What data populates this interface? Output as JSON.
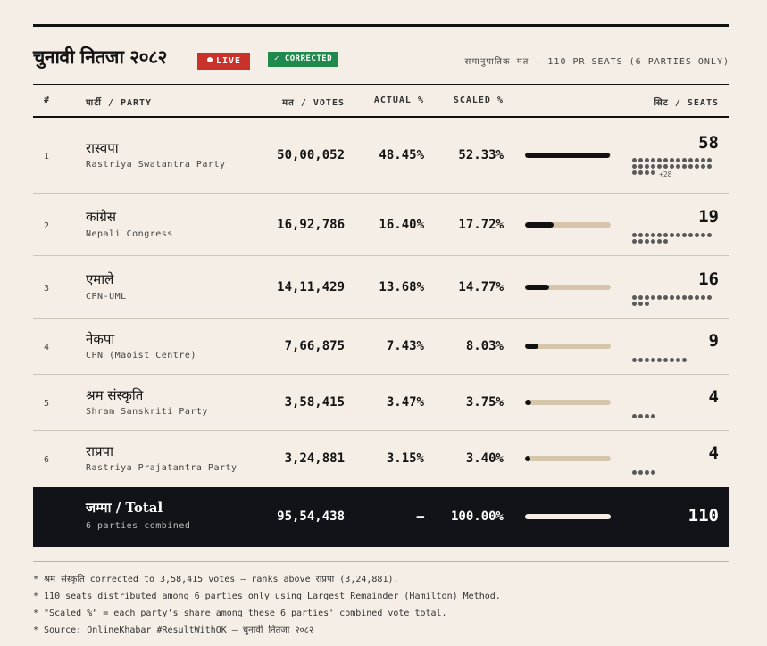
{
  "header": {
    "title": "चुनावी नितजा २०८२",
    "live_label": "LIVE",
    "corrected_label": "✓ CORRECTED",
    "subtitle": "समानुपातिक मत — 110 PR SEATS (6 PARTIES ONLY)"
  },
  "columns": {
    "rank": "#",
    "party": "पार्टी / PARTY",
    "votes": "मत / VOTES",
    "actual": "ACTUAL %",
    "scaled": "SCALED %",
    "seats": "सिट / SEATS"
  },
  "rows": [
    {
      "rank": "1",
      "name": "रास्वपा",
      "name_en": "Rastriya Swatantra Party",
      "votes": "50,00,052",
      "actual": "48.45%",
      "scaled": "52.33%",
      "share": 0.5233,
      "seats": "58",
      "dots_shown": 30,
      "extra": "+28"
    },
    {
      "rank": "2",
      "name": "कांग्रेस",
      "name_en": "Nepali Congress",
      "votes": "16,92,786",
      "actual": "16.40%",
      "scaled": "17.72%",
      "share": 0.1772,
      "seats": "19",
      "dots_shown": 19,
      "extra": ""
    },
    {
      "rank": "3",
      "name": "एमाले",
      "name_en": "CPN-UML",
      "votes": "14,11,429",
      "actual": "13.68%",
      "scaled": "14.77%",
      "share": 0.1477,
      "seats": "16",
      "dots_shown": 16,
      "extra": ""
    },
    {
      "rank": "4",
      "name": "नेकपा",
      "name_en": "CPN (Maoist Centre)",
      "votes": "7,66,875",
      "actual": "7.43%",
      "scaled": "8.03%",
      "share": 0.0803,
      "seats": "9",
      "dots_shown": 9,
      "extra": ""
    },
    {
      "rank": "5",
      "name": "श्रम संस्कृति",
      "name_en": "Shram Sanskriti Party",
      "votes": "3,58,415",
      "actual": "3.47%",
      "scaled": "3.75%",
      "share": 0.0375,
      "seats": "4",
      "dots_shown": 4,
      "extra": ""
    },
    {
      "rank": "6",
      "name": "राप्रपा",
      "name_en": "Rastriya Prajatantra Party",
      "votes": "3,24,881",
      "actual": "3.15%",
      "scaled": "3.40%",
      "share": 0.034,
      "seats": "4",
      "dots_shown": 4,
      "extra": ""
    }
  ],
  "total": {
    "name": "जम्मा / Total",
    "sub": "6 parties combined",
    "votes": "95,54,438",
    "actual": "—",
    "scaled": "100.00%",
    "share": 1.0,
    "seats": "110"
  },
  "notes": [
    "* श्रम संस्कृति corrected to 3,58,415 votes — ranks above राप्रपा (3,24,881).",
    "* 110 seats distributed among 6 parties only using Largest Remainder (Hamilton) Method.",
    "* \"Scaled %\" = each party's share among these 6 parties' combined vote total.",
    "* Source: OnlineKhabar #ResultWithOK — चुनावी नितजा २०८२"
  ],
  "colors": {
    "live": "#c8322a",
    "corrected": "#1f8a4c",
    "bar": "#111111",
    "track": "#d4c5ab"
  }
}
